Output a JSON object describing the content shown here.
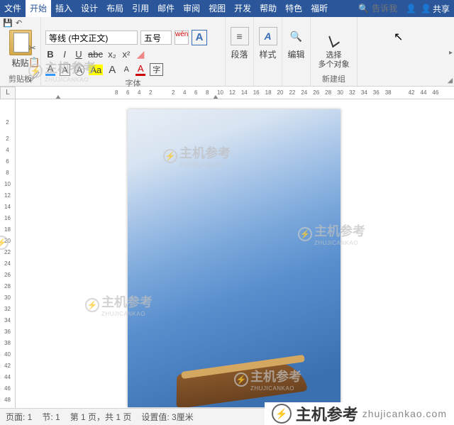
{
  "menu": {
    "tabs": [
      "文件",
      "开始",
      "插入",
      "设计",
      "布局",
      "引用",
      "邮件",
      "审阅",
      "视图",
      "开发",
      "帮助",
      "特色",
      "福昕"
    ],
    "active_index": 1,
    "search_icon": "🔍",
    "search_placeholder": "告诉我",
    "share_icon": "👤",
    "share_label": "共享"
  },
  "ribbon": {
    "clipboard": {
      "paste": "粘贴",
      "label": "剪贴板",
      "cut": "✂",
      "copy": "📋",
      "painter": "🖌"
    },
    "font": {
      "name": "等线 (中文正文)",
      "size": "五号",
      "wen": "wén",
      "bigA": "A",
      "bold": "B",
      "italic": "I",
      "underline": "U",
      "strike": "abc",
      "x2": "x₂",
      "x2_sup": "x²",
      "eraser": "◢",
      "a_fill": "A",
      "a_border": "A",
      "a_circle": "A",
      "a_highlight": "Aa",
      "a_grow": "A",
      "a_shrink": "A",
      "a_color": "A",
      "a_box": "字",
      "label": "字体"
    },
    "paragraph": {
      "icon": "≡",
      "label": "段落"
    },
    "styles": {
      "icon": "A",
      "label": "样式"
    },
    "editing": {
      "icon": "🔍",
      "label": "编辑"
    },
    "select": {
      "line1": "选择",
      "line2": "多个对象",
      "label": "新建组"
    }
  },
  "ruler": {
    "corner": "L",
    "h": [
      "8",
      "6",
      "4",
      "2",
      "",
      "2",
      "4",
      "6",
      "8",
      "10",
      "12",
      "14",
      "16",
      "18",
      "20",
      "22",
      "24",
      "26",
      "28",
      "30",
      "32",
      "34",
      "36",
      "38",
      "",
      "42",
      "44",
      "46"
    ],
    "v": [
      "2",
      "",
      "2",
      "4",
      "6",
      "8",
      "10",
      "12",
      "14",
      "16",
      "18",
      "20",
      "22",
      "24",
      "26",
      "28",
      "30",
      "32",
      "34",
      "36",
      "38",
      "40",
      "42",
      "44",
      "46",
      "48"
    ]
  },
  "statusbar": {
    "page": "页面: 1",
    "section": "节: 1",
    "pages": "第 1 页，共 1 页",
    "setting": "设置值: 3厘米"
  },
  "watermark": {
    "big": "主机参考",
    "small": "ZHUJICANKAO",
    "symbol": "⚡"
  },
  "footer": {
    "symbol": "⚡",
    "main": "主机参考",
    "sub": "zhujicankao.com"
  }
}
